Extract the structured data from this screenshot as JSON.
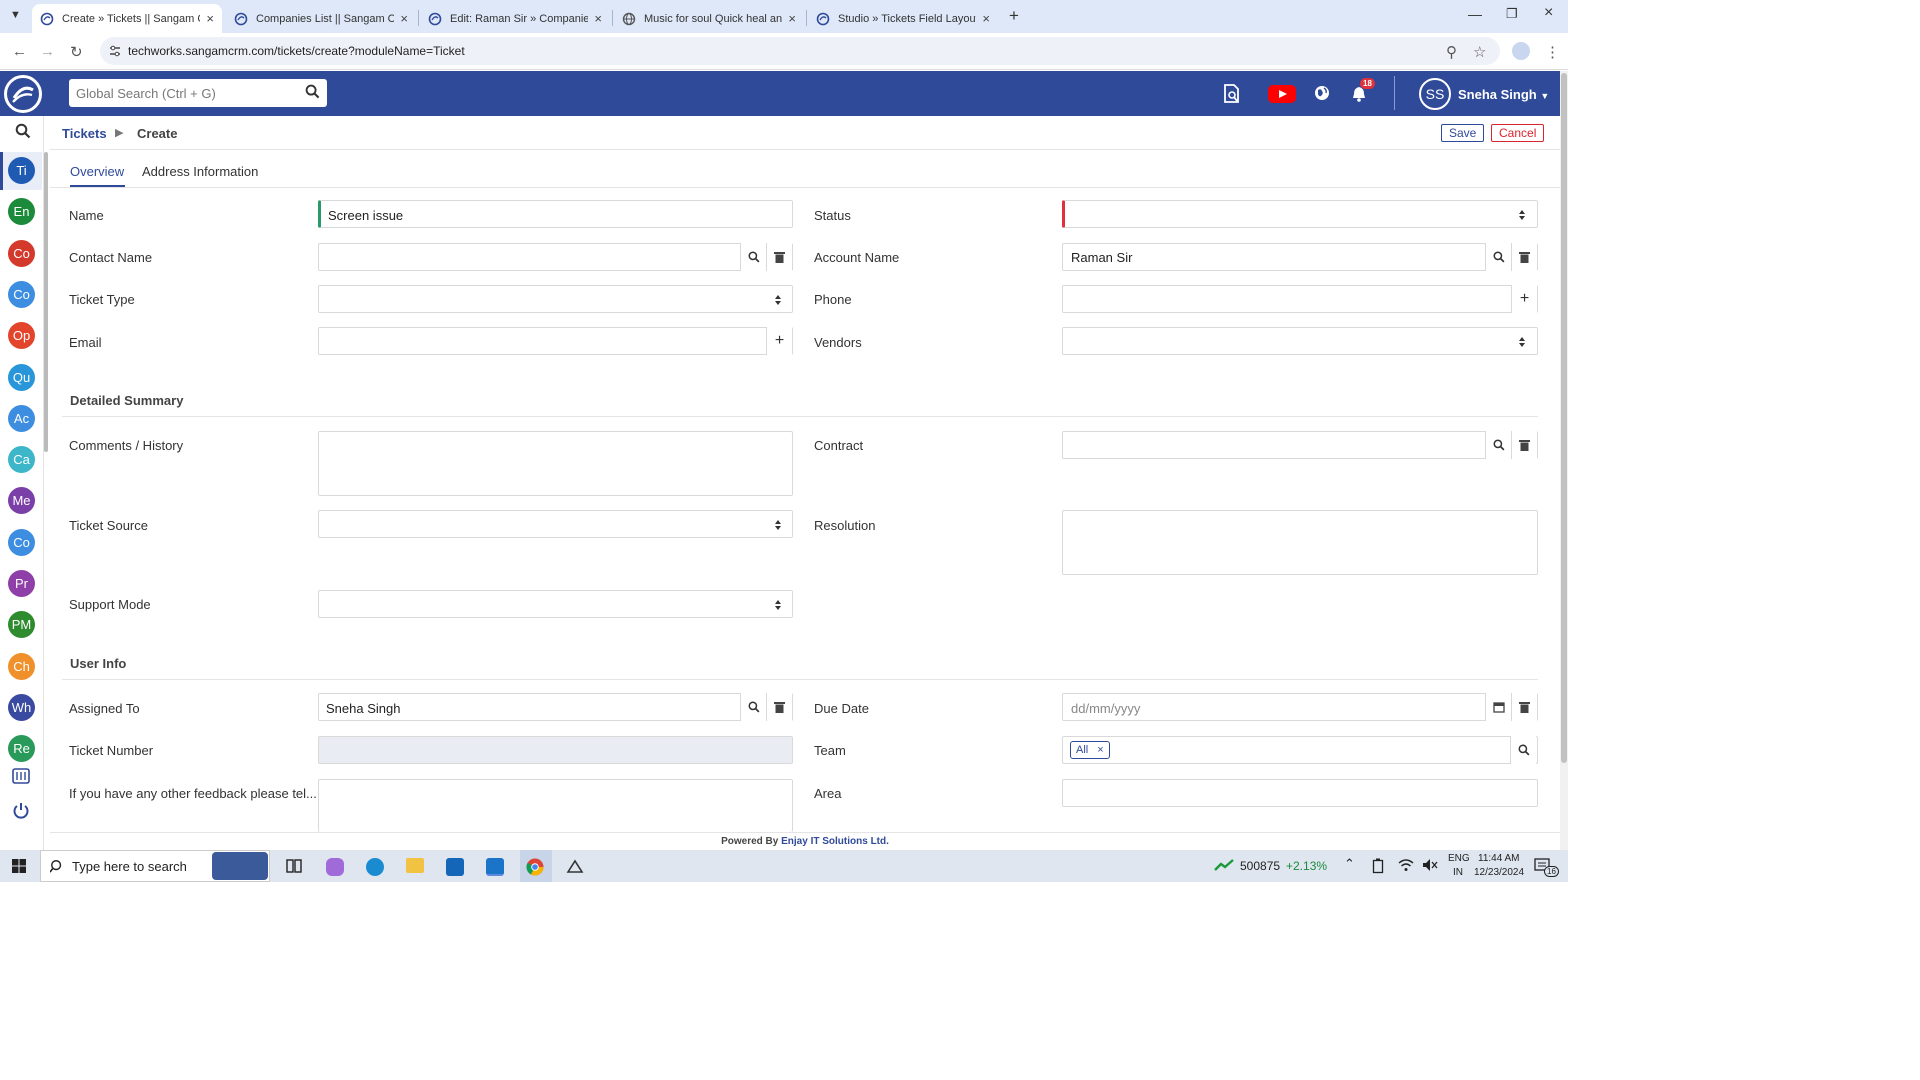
{
  "browser": {
    "tabs": [
      {
        "title": "Create » Tickets || Sangam CRM",
        "active": true
      },
      {
        "title": "Companies List || Sangam CRM",
        "active": false
      },
      {
        "title": "Edit: Raman Sir » Companies || S",
        "active": false
      },
      {
        "title": "Music for soul Quick heal antivi",
        "active": false
      },
      {
        "title": "Studio » Tickets Field Layout || S",
        "active": false
      }
    ],
    "url": "techworks.sangamcrm.com/tickets/create?moduleName=Ticket"
  },
  "header": {
    "search_placeholder": "Global Search (Ctrl + G)",
    "notifications_count": "18",
    "avatar_initials": "SS",
    "user_name": "Sneha Singh",
    "colors": {
      "bar": "#304a9a",
      "badge": "#e0323c"
    }
  },
  "rail": {
    "modules": [
      {
        "abbr": "Ti",
        "color": "#1f5bb3"
      },
      {
        "abbr": "En",
        "color": "#1b8a3a"
      },
      {
        "abbr": "Co",
        "color": "#d33a2c"
      },
      {
        "abbr": "Co",
        "color": "#3d8ee0"
      },
      {
        "abbr": "Op",
        "color": "#e2452b"
      },
      {
        "abbr": "Qu",
        "color": "#2896d8"
      },
      {
        "abbr": "Ac",
        "color": "#3d8ee0"
      },
      {
        "abbr": "Ca",
        "color": "#3cb6c8"
      },
      {
        "abbr": "Me",
        "color": "#7b3fa8"
      },
      {
        "abbr": "Co",
        "color": "#3d8ee0"
      },
      {
        "abbr": "Pr",
        "color": "#8e3fa8"
      },
      {
        "abbr": "PM",
        "color": "#2e8b2e"
      },
      {
        "abbr": "Ch",
        "color": "#f0902b"
      },
      {
        "abbr": "Wh",
        "color": "#3a4aa0"
      },
      {
        "abbr": "Re",
        "color": "#2a9a5a"
      }
    ]
  },
  "breadcrumb": {
    "module": "Tickets",
    "page": "Create"
  },
  "actions": {
    "save": "Save",
    "cancel": "Cancel"
  },
  "form_tabs": [
    "Overview",
    "Address Information"
  ],
  "fields": {
    "name": {
      "label": "Name",
      "value": "Screen issue"
    },
    "status": {
      "label": "Status",
      "value": ""
    },
    "contact_name": {
      "label": "Contact Name",
      "value": ""
    },
    "account_name": {
      "label": "Account Name",
      "value": "Raman Sir"
    },
    "ticket_type": {
      "label": "Ticket Type",
      "value": ""
    },
    "phone": {
      "label": "Phone",
      "value": ""
    },
    "email": {
      "label": "Email",
      "value": ""
    },
    "vendors": {
      "label": "Vendors",
      "value": ""
    },
    "comments": {
      "label": "Comments / History",
      "value": ""
    },
    "contract": {
      "label": "Contract",
      "value": ""
    },
    "ticket_source": {
      "label": "Ticket Source",
      "value": ""
    },
    "resolution": {
      "label": "Resolution",
      "value": ""
    },
    "support_mode": {
      "label": "Support Mode",
      "value": ""
    },
    "assigned_to": {
      "label": "Assigned To",
      "value": "Sneha Singh"
    },
    "due_date": {
      "label": "Due Date",
      "placeholder": "dd/mm/yyyy"
    },
    "ticket_number": {
      "label": "Ticket Number",
      "value": ""
    },
    "team": {
      "label": "Team",
      "tag": "All"
    },
    "feedback": {
      "label": "If you have any other feedback please tel..."
    },
    "area": {
      "label": "Area",
      "value": ""
    }
  },
  "sections": {
    "detailed_summary": "Detailed Summary",
    "user_info": "User Info"
  },
  "footer": {
    "prefix": "Powered By",
    "company": "Enjay IT Solutions Ltd."
  },
  "taskbar": {
    "search_placeholder": "Type here to search",
    "stock_value": "500875",
    "stock_change": "+2.13%",
    "lang1": "ENG",
    "lang2": "IN",
    "time": "11:44 AM",
    "date": "12/23/2024",
    "notif_count": "16"
  }
}
